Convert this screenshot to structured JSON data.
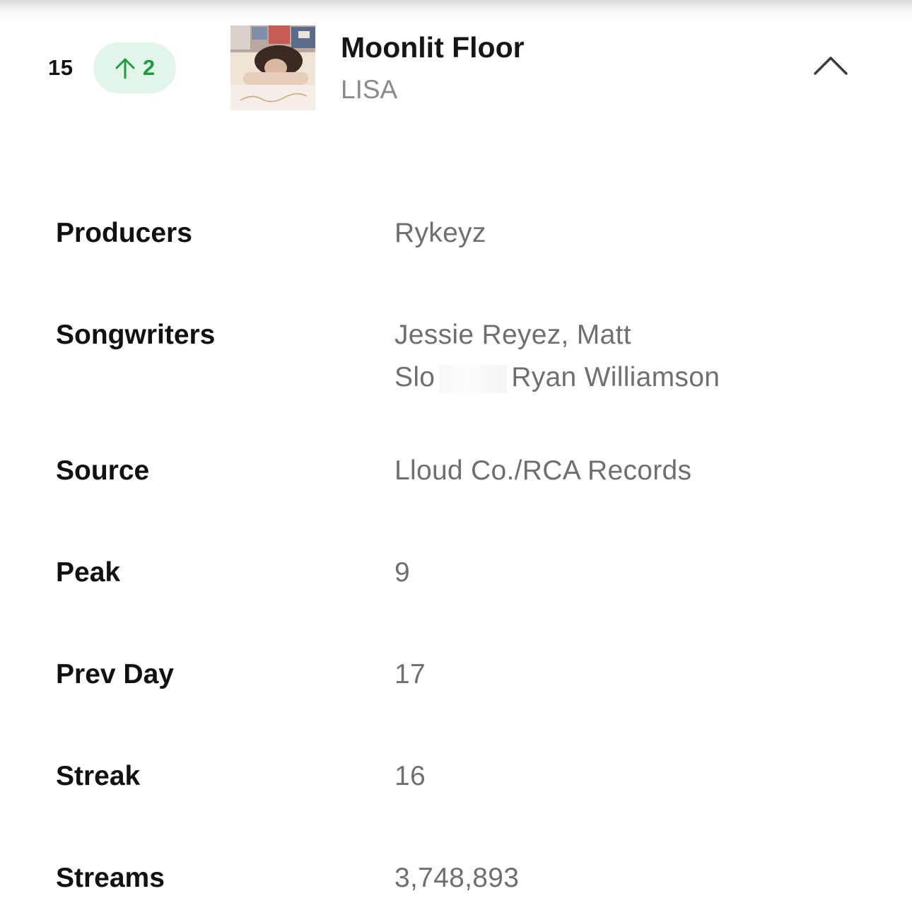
{
  "track": {
    "rank": "15",
    "change": "2",
    "change_direction": "up",
    "title": "Moonlit Floor",
    "artist": "LISA",
    "cover_icon": "album-cover-image",
    "collapse_icon": "chevron-up-icon"
  },
  "details": {
    "producers": {
      "label": "Producers",
      "value": "Rykeyz"
    },
    "songwriters": {
      "label": "Songwriters",
      "line1": "Jessie Reyez, Matt",
      "line2_start": "Slo",
      "line2_end": "Ryan Williamson"
    },
    "source": {
      "label": "Source",
      "value": "Lloud Co./RCA Records"
    },
    "peak": {
      "label": "Peak",
      "value": "9"
    },
    "prev_day": {
      "label": "Prev Day",
      "value": "17"
    },
    "streak": {
      "label": "Streak",
      "value": "16"
    },
    "streams": {
      "label": "Streams",
      "value": "3,748,893"
    }
  },
  "colors": {
    "accent_green": "#1f9a45",
    "badge_bg": "#e3f5e8",
    "label_text": "#111111",
    "value_text": "#6f6f6f"
  }
}
